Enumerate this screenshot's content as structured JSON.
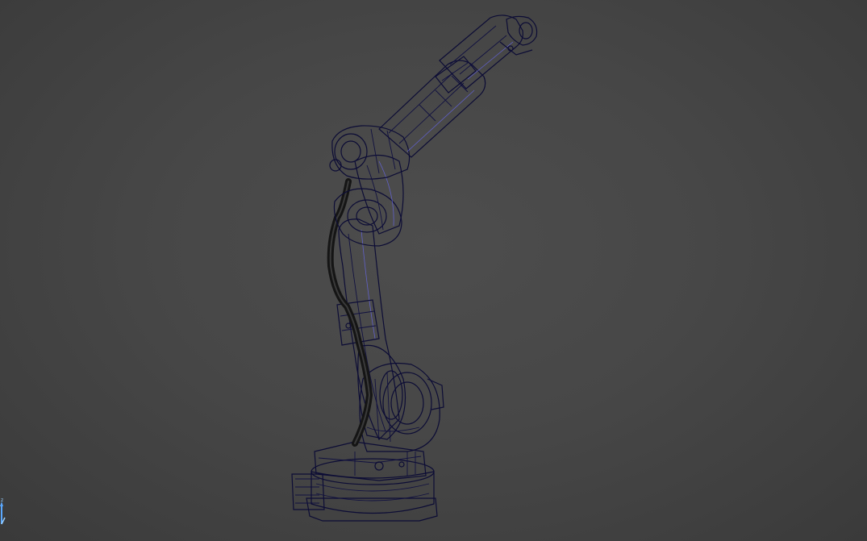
{
  "app": {
    "view": "3d-viewport"
  },
  "colors": {
    "background": "#464646",
    "robot_body": "#2b22ee",
    "robot_shadow": "#1a14b8",
    "robot_highlight": "#4a44ff",
    "cable": "#1b1b1b",
    "axis_triad": "#5aa8ff"
  },
  "icons": {
    "axis_triad": "axis-triad-icon"
  },
  "model": {
    "name_visible": false
  }
}
